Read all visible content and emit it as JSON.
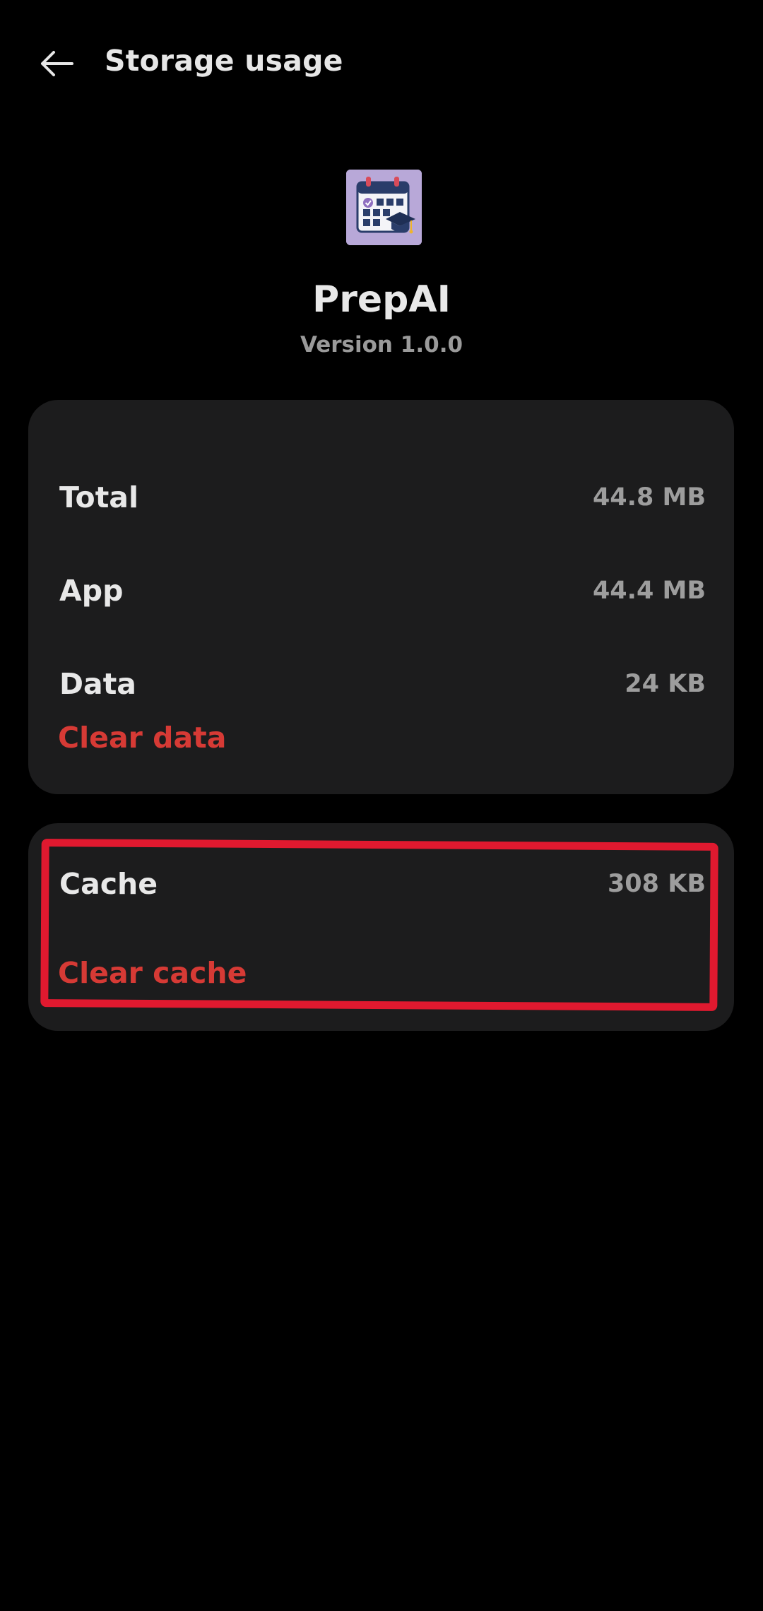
{
  "header": {
    "title": "Storage usage",
    "back_icon": "arrow-left-icon"
  },
  "app": {
    "name": "PrepAI",
    "version": "Version 1.0.0",
    "icon": "calendar-graduation-cap-icon"
  },
  "storage": {
    "rows": [
      {
        "label": "Total",
        "value": "44.8 MB"
      },
      {
        "label": "App",
        "value": "44.4 MB"
      },
      {
        "label": "Data",
        "value": "24 KB"
      }
    ],
    "clear_data_label": "Clear data"
  },
  "cache": {
    "label": "Cache",
    "value": "308 KB",
    "clear_cache_label": "Clear cache"
  },
  "colors": {
    "background": "#000000",
    "card": "#1c1c1d",
    "action_red": "#d63a35",
    "highlight_red": "#e0192f",
    "secondary_text": "#9d9d9d"
  }
}
